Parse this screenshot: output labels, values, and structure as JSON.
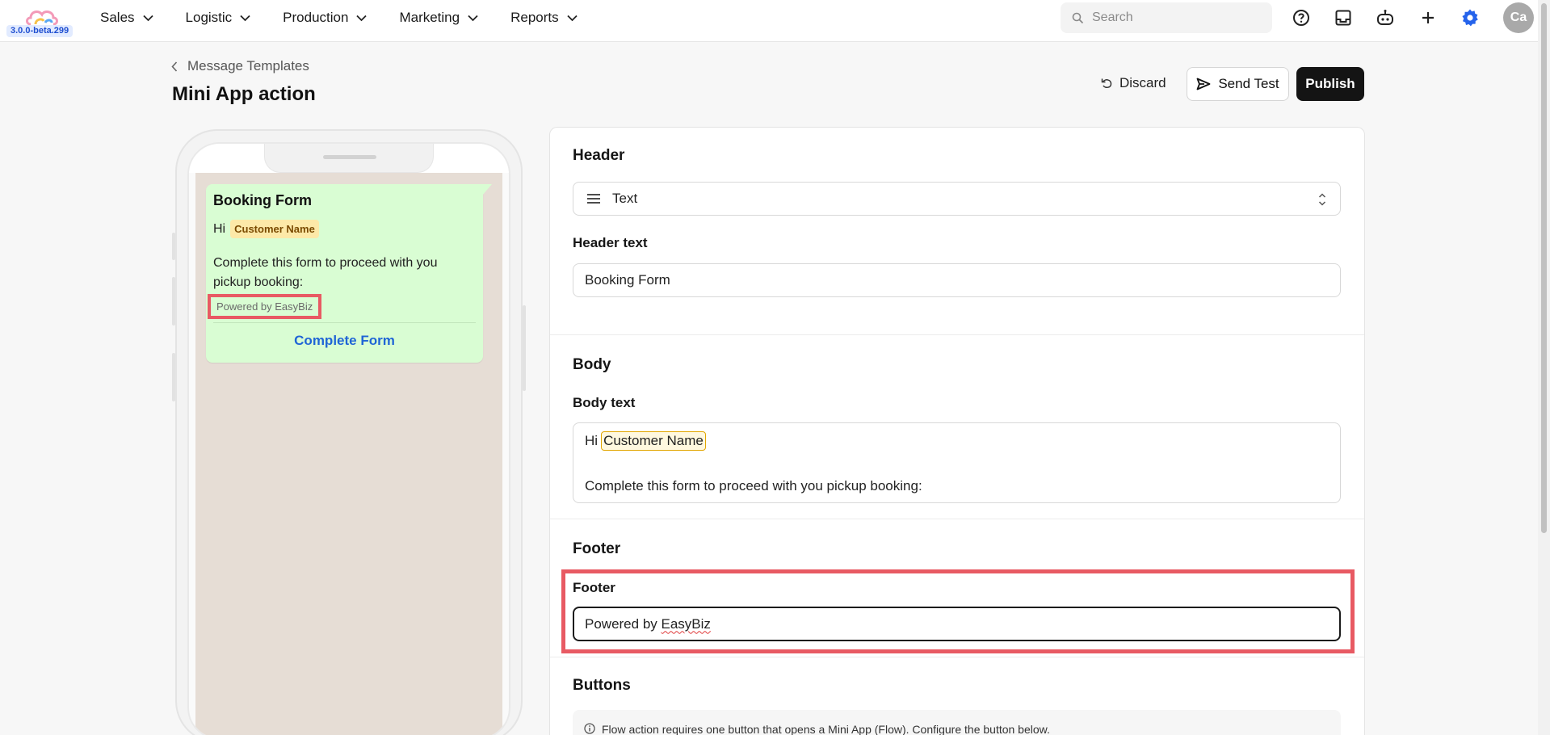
{
  "app": {
    "version": "3.0.0-beta.299",
    "logo_icon": "cloud-logo-icon"
  },
  "nav": {
    "items": [
      {
        "label": "Sales"
      },
      {
        "label": "Logistic"
      },
      {
        "label": "Production"
      },
      {
        "label": "Marketing"
      },
      {
        "label": "Reports"
      }
    ],
    "search_placeholder": "Search",
    "avatar_initials": "Ca",
    "icons": [
      "help-circle-icon",
      "inbox-icon",
      "robot-icon",
      "plus-icon",
      "settings-gear-icon"
    ],
    "accent_color": "#2563eb"
  },
  "page": {
    "breadcrumb": "Message Templates",
    "title": "Mini App action",
    "discard_label": "Discard",
    "send_test_label": "Send Test",
    "publish_label": "Publish"
  },
  "preview": {
    "title": "Booking Form",
    "greeting": "Hi",
    "variable_chip": "Customer Name",
    "body": "Complete this form to proceed with you pickup booking:",
    "footer": "Powered by EasyBiz",
    "action_label": "Complete Form",
    "bubble_color": "#d9fdd3",
    "highlight_color": "#e85a63"
  },
  "form": {
    "header": {
      "section_title": "Header",
      "type_value": "Text",
      "text_label": "Header text",
      "text_value": "Booking Form"
    },
    "body": {
      "section_title": "Body",
      "text_label": "Body text",
      "line1_prefix": "Hi",
      "line1_variable": "Customer Name",
      "line2": "Complete this form to proceed with you pickup booking:"
    },
    "footer": {
      "section_title": "Footer",
      "field_label": "Footer",
      "value_prefix": "Powered by ",
      "value_brand": "EasyBiz"
    },
    "buttons": {
      "section_title": "Buttons",
      "info": "Flow action requires one button that opens a Mini App (Flow). Configure the button below."
    }
  }
}
